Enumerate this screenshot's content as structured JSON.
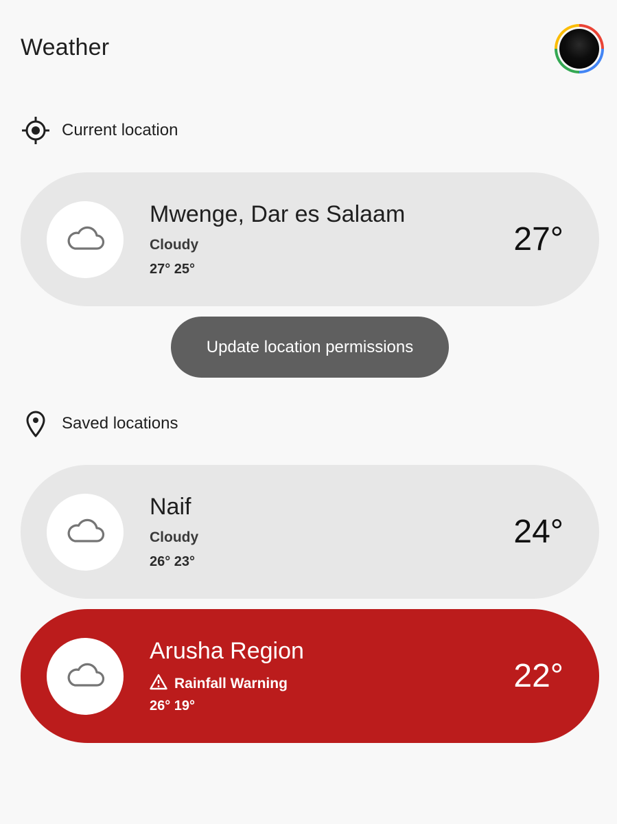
{
  "header": {
    "title": "Weather",
    "avatar_icon": "user-avatar"
  },
  "current_section": {
    "label": "Current location",
    "icon": "my-location-icon",
    "card": {
      "name": "Mwenge, Dar es Salaam",
      "condition": "Cloudy",
      "range": "27° 25°",
      "temp": "27°",
      "icon": "cloud-icon"
    },
    "update_button": "Update location permissions"
  },
  "saved_section": {
    "label": "Saved locations",
    "icon": "location-pin-icon",
    "cards": [
      {
        "name": "Naif",
        "condition": "Cloudy",
        "range": "26° 23°",
        "temp": "24°",
        "icon": "cloud-icon"
      },
      {
        "name": "Arusha Region",
        "condition": "Rainfall Warning",
        "condition_icon": "warning-icon",
        "range": "26° 19°",
        "temp": "22°",
        "icon": "cloud-icon",
        "alert_color": "#bb1c1c"
      }
    ]
  },
  "colors": {
    "background": "#f8f8f8",
    "card": "#e7e7e7",
    "alert": "#bb1c1c",
    "button": "#5f5f5f"
  }
}
